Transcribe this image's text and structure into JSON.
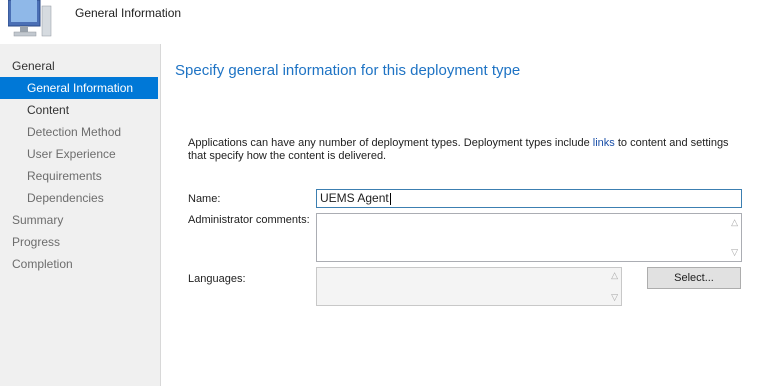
{
  "header": {
    "title": "General Information"
  },
  "sidebar": {
    "items": [
      {
        "label": "General"
      },
      {
        "label": "General Information"
      },
      {
        "label": "Content"
      },
      {
        "label": "Detection Method"
      },
      {
        "label": "User Experience"
      },
      {
        "label": "Requirements"
      },
      {
        "label": "Dependencies"
      },
      {
        "label": "Summary"
      },
      {
        "label": "Progress"
      },
      {
        "label": "Completion"
      }
    ]
  },
  "main": {
    "title": "Specify general information for this deployment type",
    "description_part1": "Applications can have any number of deployment types. Deployment types include ",
    "description_link": "links",
    "description_part2": " to content and settings that specify how the content is delivered.",
    "name_label": "Name:",
    "name_value": "UEMS Agent",
    "comments_label": "Administrator comments:",
    "languages_label": "Languages:",
    "select_button": "Select..."
  },
  "colors": {
    "accent": "#0078d7",
    "title": "#1e73c4",
    "sidebar_bg": "#f0f0f0"
  },
  "icons": {
    "header": "computer-icon",
    "scroll_up": "scroll-up-icon",
    "scroll_down": "scroll-down-icon"
  }
}
